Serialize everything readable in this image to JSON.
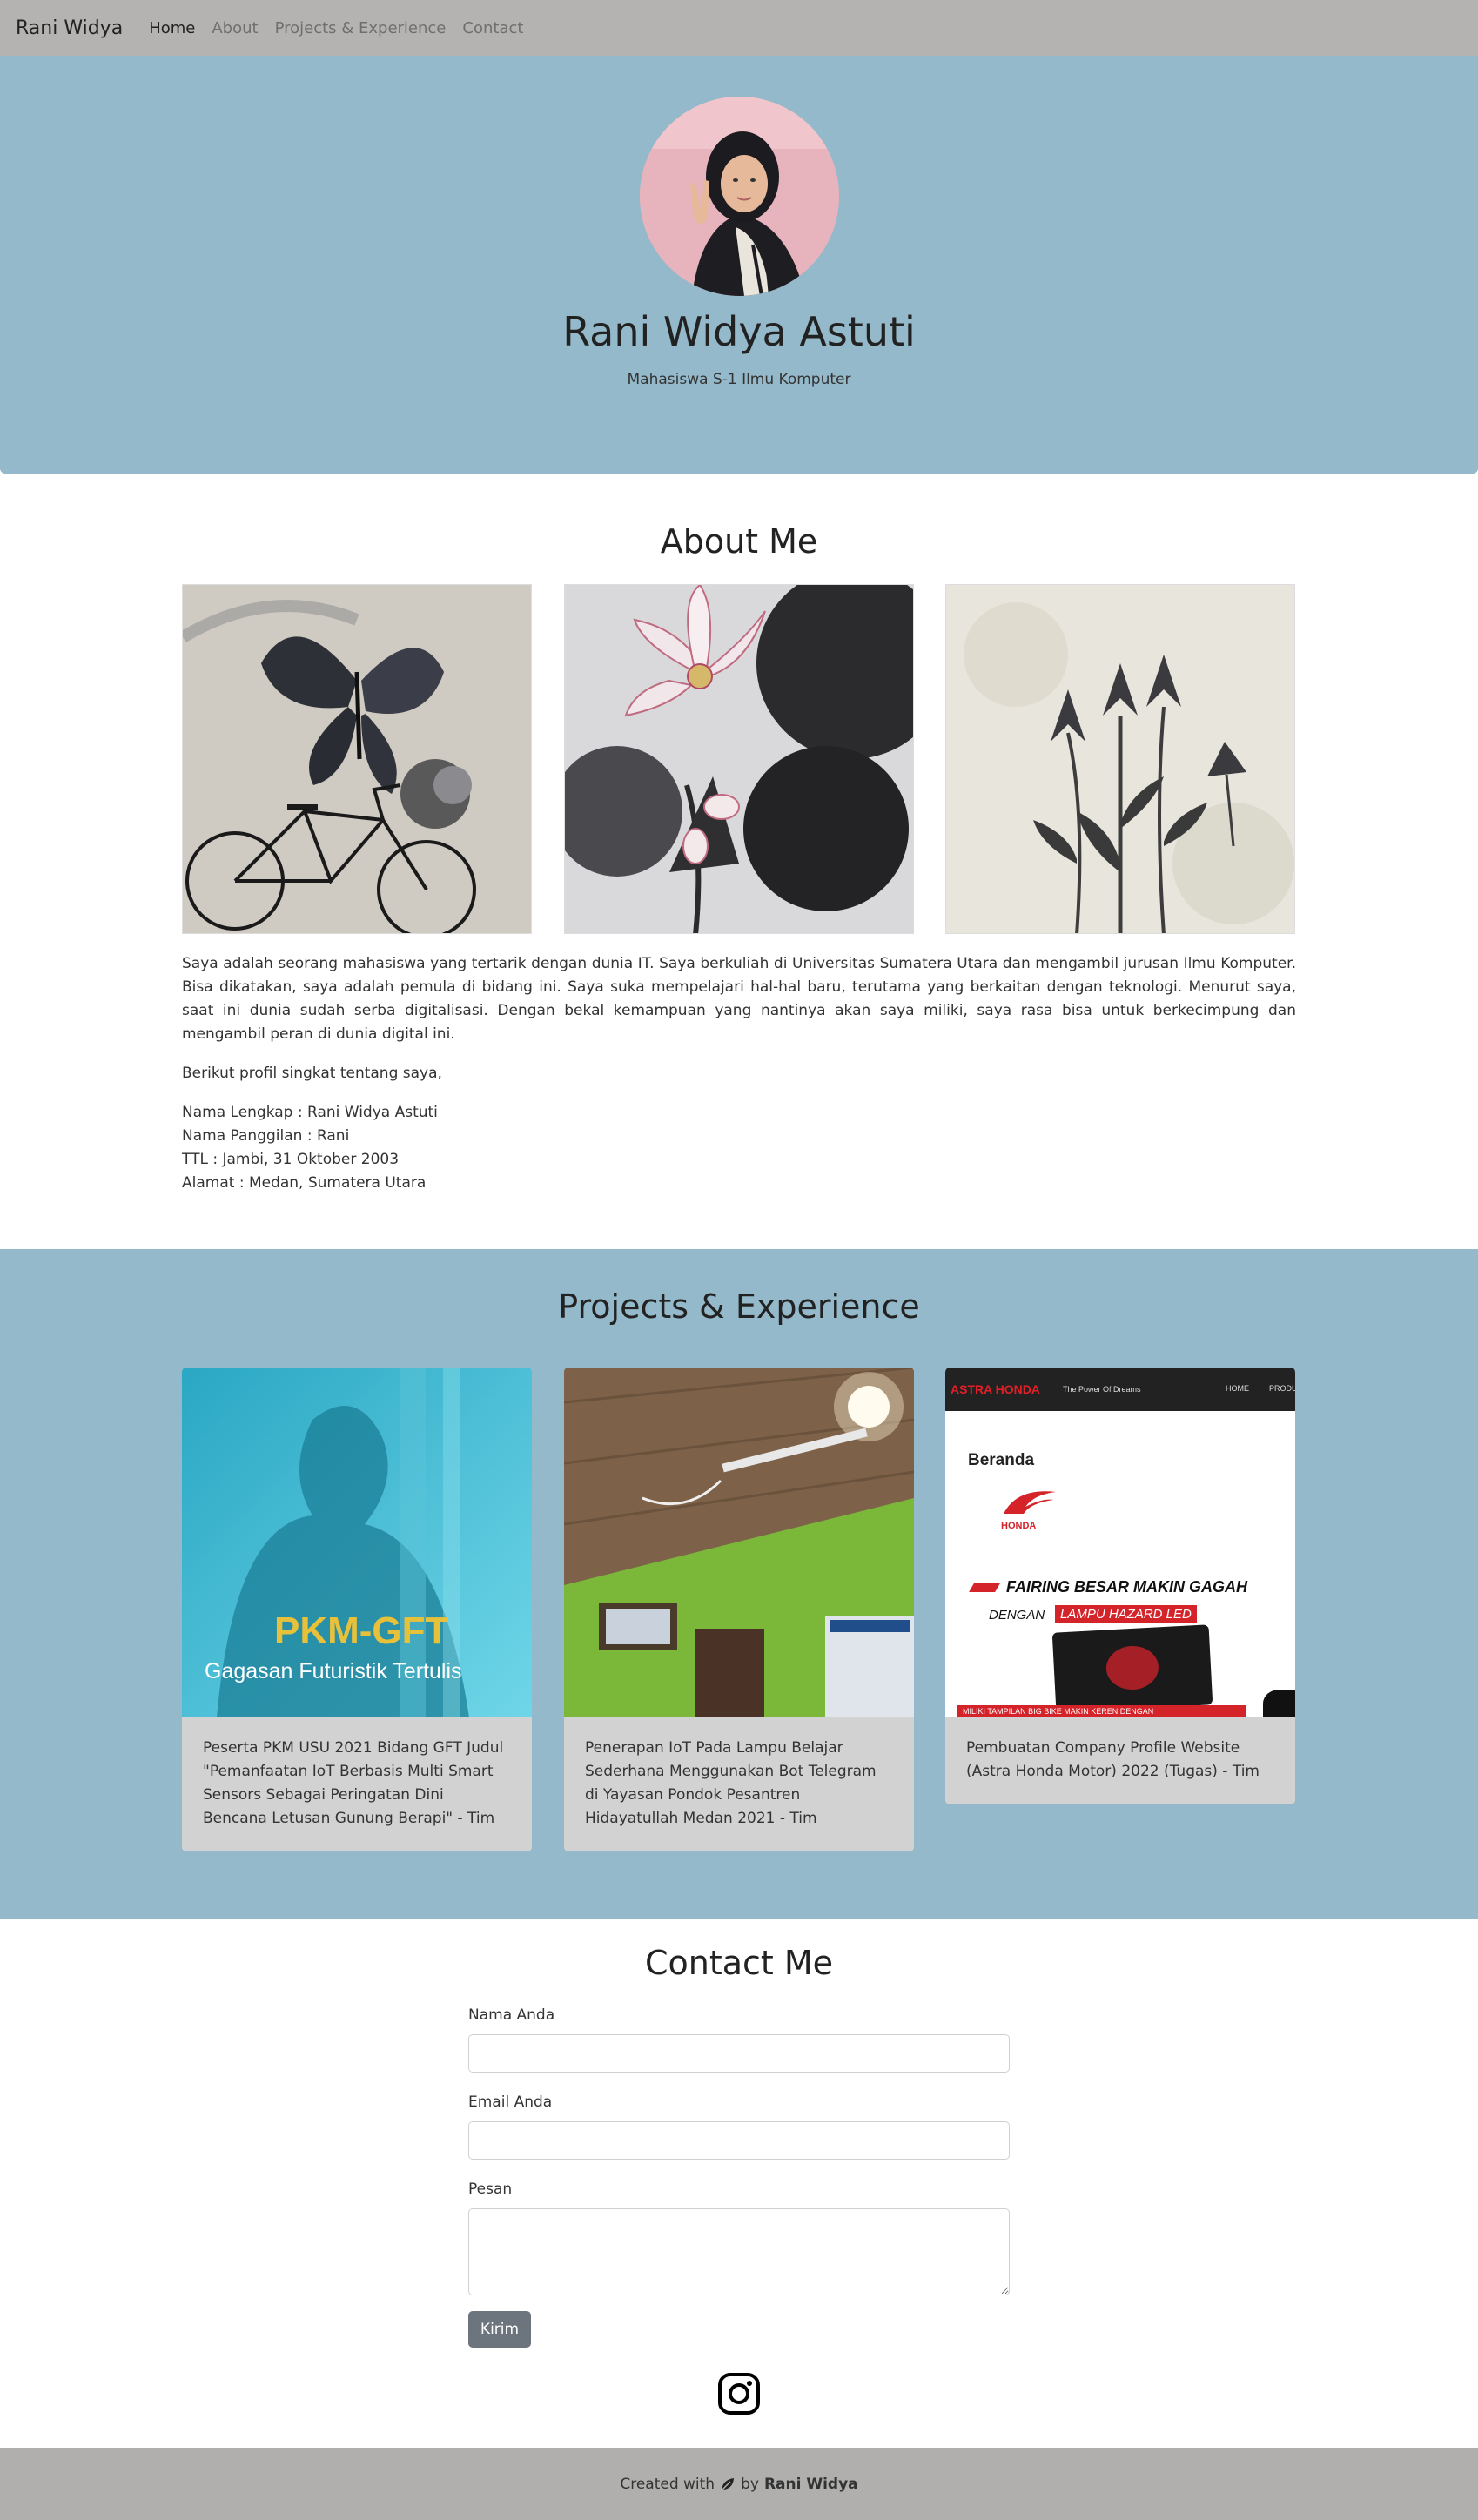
{
  "nav": {
    "brand": "Rani Widya",
    "links": [
      "Home",
      "About",
      "Projects & Experience",
      "Contact"
    ]
  },
  "hero": {
    "name": "Rani Widya Astuti",
    "subtitle": "Mahasiswa S-1 Ilmu Komputer"
  },
  "about": {
    "title": "About Me",
    "paragraph": "Saya adalah seorang mahasiswa yang tertarik dengan dunia IT. Saya berkuliah di Universitas Sumatera Utara dan mengambil jurusan Ilmu Komputer. Bisa dikatakan, saya adalah pemula di bidang ini. Saya suka mempelajari hal-hal baru, terutama yang berkaitan dengan teknologi. Menurut saya, saat ini dunia sudah serba digitalisasi. Dengan bekal kemampuan yang nantinya akan saya miliki, saya rasa bisa untuk berkecimpung dan mengambil peran di dunia digital ini.",
    "intro": "Berikut profil singkat tentang saya,",
    "profile": [
      "Nama Lengkap : Rani Widya Astuti",
      "Nama Panggilan : Rani",
      "TTL : Jambi, 31 Oktober 2003",
      "Alamat : Medan, Sumatera Utara"
    ]
  },
  "projects": {
    "title": "Projects & Experience",
    "cards": [
      {
        "image_title": "PKM-GFT",
        "image_subtitle": "Gagasan Futuristik Tertulis",
        "text": "Peserta PKM USU 2021 Bidang GFT Judul \"Pemanfaatan IoT Berbasis Multi Smart Sensors Sebagai Peringatan Dini Bencana Letusan Gunung Berapi\" - Tim"
      },
      {
        "text": "Penerapan IoT Pada Lampu Belajar Sederhana Menggunakan Bot Telegram di Yayasan Pondok Pesantren Hidayatullah Medan 2021 - Tim"
      },
      {
        "site_brand": "ASTRA HONDA",
        "site_tagline": "The Power Of Dreams",
        "site_nav": [
          "HOME",
          "PRODU"
        ],
        "site_heading": "Beranda",
        "site_logo_text": "HONDA",
        "banner_line1": "FAIRING BESAR MAKIN GAGAH",
        "banner_line2a": "DENGAN",
        "banner_line2b": "LAMPU HAZARD LED",
        "banner_footer": "MILIKI TAMPILAN BIG BIKE MAKIN KEREN DENGAN",
        "text": "Pembuatan Company Profile Website (Astra Honda Motor) 2022 (Tugas) - Tim"
      }
    ]
  },
  "contact": {
    "title": "Contact Me",
    "name_label": "Nama Anda",
    "email_label": "Email Anda",
    "message_label": "Pesan",
    "submit_label": "Kirim"
  },
  "footer": {
    "prefix": "Created with",
    "by": "by",
    "author": "Rani Widya"
  },
  "icons": [
    "instagram-icon",
    "leaf-icon"
  ],
  "colors": {
    "navbar": "#b4b3b2",
    "hero": "#94b9ca",
    "card": "#d3d2d2",
    "button": "#6c747d",
    "footer": "#b0afae"
  }
}
